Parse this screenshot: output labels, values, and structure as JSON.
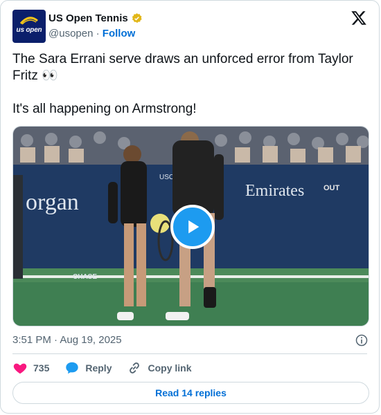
{
  "account": {
    "name": "US Open Tennis",
    "handle": "@usopen",
    "separator": "·",
    "follow_label": "Follow",
    "avatar_text": "us open",
    "brand_color": "#0b1f6b",
    "verified_color": "#e2b719"
  },
  "tweet": {
    "text": "The Sara Errani serve draws an unforced error from Taylor Fritz 👀\n\nIt's all happening on Armstrong!",
    "timestamp": "3:51 PM · Aug 19, 2025"
  },
  "media": {
    "signage": {
      "sponsor_left": "organ",
      "sponsor_right": "Emirates",
      "out_label": "OUT",
      "chase_label": "CHASE",
      "usopen_small": "USO"
    },
    "play_icon": "play-icon"
  },
  "actions": {
    "likes": "735",
    "reply_label": "Reply",
    "copy_label": "Copy link"
  },
  "footer": {
    "read_replies": "Read 14 replies"
  },
  "colors": {
    "accent": "#1d9bf0",
    "link": "#006fd6",
    "heart": "#f91880",
    "muted": "#536471"
  }
}
